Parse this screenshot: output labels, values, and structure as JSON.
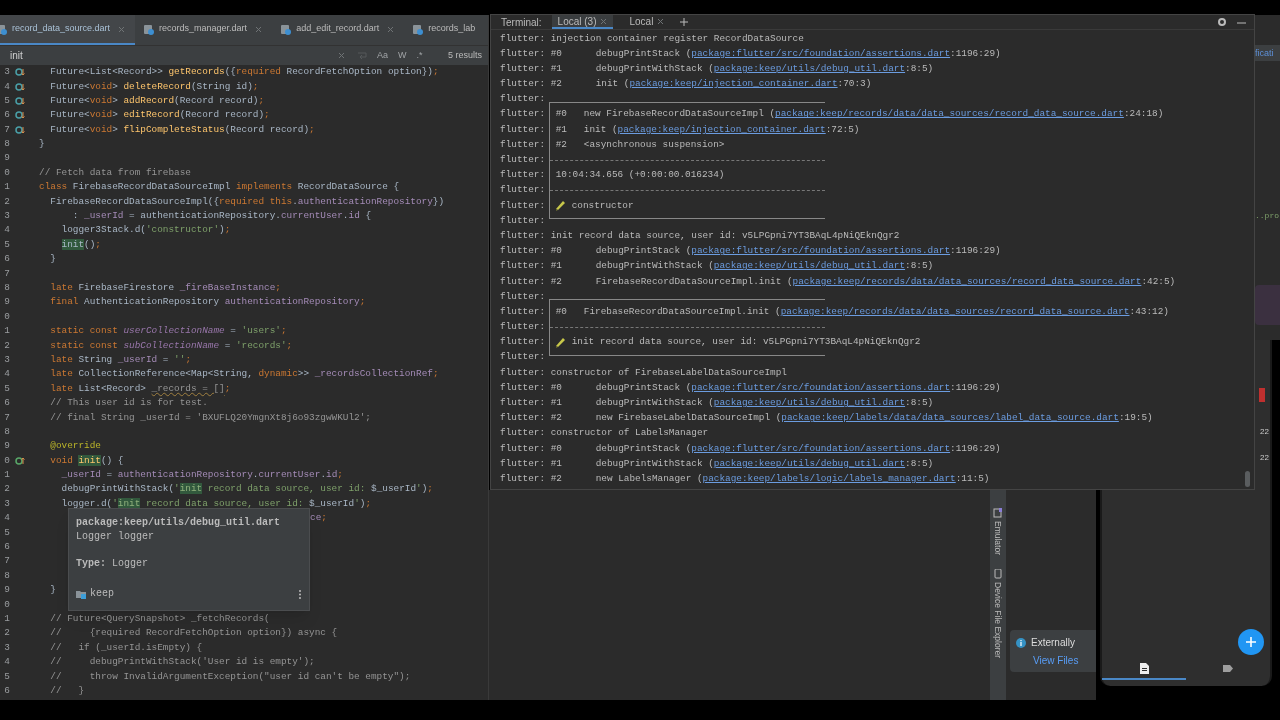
{
  "editor": {
    "tabs": [
      {
        "label": "record_data_source.dart",
        "selected": true,
        "closable": true
      },
      {
        "label": "records_manager.dart",
        "selected": false,
        "closable": true
      },
      {
        "label": "add_edit_record.dart",
        "selected": false,
        "closable": true
      },
      {
        "label": "records_lab",
        "selected": false,
        "closable": false
      }
    ],
    "search": {
      "query": "init",
      "options": [
        "Aa",
        "W",
        ".*"
      ],
      "results": "5 results"
    },
    "lines": [
      {
        "n": "3",
        "code": [
          {
            "t": "  Future<List<Record>> ",
            "kind": "plain"
          },
          {
            "t": "getRecords",
            "kind": "fn"
          },
          {
            "t": "({",
            "kind": "plain"
          },
          {
            "t": "required",
            "kind": "kw"
          },
          {
            "t": " RecordFetchOption option})",
            "kind": "plain"
          },
          {
            "t": ";",
            "kind": "kw"
          }
        ],
        "gutter": {
          "kind": "implemented"
        }
      },
      {
        "n": "4",
        "code": [
          {
            "t": "  Future<",
            "kind": "plain"
          },
          {
            "t": "void",
            "kind": "kw"
          },
          {
            "t": "> ",
            "kind": "plain"
          },
          {
            "t": "deleteRecord",
            "kind": "fn"
          },
          {
            "t": "(String id)",
            "kind": "plain"
          },
          {
            "t": ";",
            "kind": "kw"
          }
        ],
        "gutter": {
          "kind": "implemented"
        }
      },
      {
        "n": "5",
        "code": [
          {
            "t": "  Future<",
            "kind": "plain"
          },
          {
            "t": "void",
            "kind": "kw"
          },
          {
            "t": "> ",
            "kind": "plain"
          },
          {
            "t": "addRecord",
            "kind": "fn"
          },
          {
            "t": "(Record record)",
            "kind": "plain"
          },
          {
            "t": ";",
            "kind": "kw"
          }
        ],
        "gutter": {
          "kind": "implemented"
        }
      },
      {
        "n": "6",
        "code": [
          {
            "t": "  Future<",
            "kind": "plain"
          },
          {
            "t": "void",
            "kind": "kw"
          },
          {
            "t": "> ",
            "kind": "plain"
          },
          {
            "t": "editRecord",
            "kind": "fn"
          },
          {
            "t": "(Record record)",
            "kind": "plain"
          },
          {
            "t": ";",
            "kind": "kw"
          }
        ],
        "gutter": {
          "kind": "implemented"
        }
      },
      {
        "n": "7",
        "code": [
          {
            "t": "  Future<",
            "kind": "plain"
          },
          {
            "t": "void",
            "kind": "kw"
          },
          {
            "t": "> ",
            "kind": "plain"
          },
          {
            "t": "flipCompleteStatus",
            "kind": "fn"
          },
          {
            "t": "(Record record)",
            "kind": "plain"
          },
          {
            "t": ";",
            "kind": "kw"
          }
        ],
        "gutter": {
          "kind": "implemented"
        }
      },
      {
        "n": "8",
        "code": [
          {
            "t": "}",
            "kind": "plain"
          }
        ]
      },
      {
        "n": "9"
      },
      {
        "n": "0",
        "code": [
          {
            "t": "// Fetch data from firebase",
            "kind": "cm"
          }
        ]
      },
      {
        "n": "1",
        "code": [
          {
            "t": "class",
            "kind": "kw"
          },
          {
            "t": " FirebaseRecordDataSourceImpl ",
            "kind": "plain"
          },
          {
            "t": "implements",
            "kind": "kw"
          },
          {
            "t": " RecordDataSource {",
            "kind": "plain"
          }
        ]
      },
      {
        "n": "2",
        "code": [
          {
            "t": "  FirebaseRecordDataSourceImpl({",
            "kind": "plain"
          },
          {
            "t": "required this",
            "kind": "kw"
          },
          {
            "t": ".",
            "kind": "plain"
          },
          {
            "t": "authenticationRepository",
            "kind": "field"
          },
          {
            "t": "})",
            "kind": "plain"
          }
        ]
      },
      {
        "n": "3",
        "code": [
          {
            "t": "      : ",
            "kind": "plain"
          },
          {
            "t": "_userId",
            "kind": "field"
          },
          {
            "t": " = authenticationRepository.",
            "kind": "plain"
          },
          {
            "t": "currentUser",
            "kind": "field"
          },
          {
            "t": ".",
            "kind": "plain"
          },
          {
            "t": "id",
            "kind": "field"
          },
          {
            "t": " {",
            "kind": "plain"
          }
        ]
      },
      {
        "n": "4",
        "code": [
          {
            "t": "    logger3Stack.d(",
            "kind": "plain"
          },
          {
            "t": "'constructor'",
            "kind": "str"
          },
          {
            "t": ")",
            "kind": "plain"
          },
          {
            "t": ";",
            "kind": "kw"
          }
        ]
      },
      {
        "n": "5",
        "code": [
          {
            "t": "    init",
            "kind": "match"
          },
          {
            "t": "()",
            "kind": "plain"
          },
          {
            "t": ";",
            "kind": "kw"
          }
        ]
      },
      {
        "n": "6",
        "code": [
          {
            "t": "  }",
            "kind": "plain"
          }
        ]
      },
      {
        "n": "7"
      },
      {
        "n": "8",
        "code": [
          {
            "t": "  late",
            "kind": "kw"
          },
          {
            "t": " FirebaseFirestore ",
            "kind": "plain"
          },
          {
            "t": "_fireBaseInstance",
            "kind": "field"
          },
          {
            "t": ";",
            "kind": "kw"
          }
        ]
      },
      {
        "n": "9",
        "code": [
          {
            "t": "  final",
            "kind": "kw"
          },
          {
            "t": " AuthenticationRepository ",
            "kind": "plain"
          },
          {
            "t": "authenticationRepository",
            "kind": "field"
          },
          {
            "t": ";",
            "kind": "kw"
          }
        ]
      },
      {
        "n": "0"
      },
      {
        "n": "1",
        "code": [
          {
            "t": "  static const ",
            "kind": "kw"
          },
          {
            "t": "userCollectionName",
            "kind": "sfield"
          },
          {
            "t": " = ",
            "kind": "plain"
          },
          {
            "t": "'users'",
            "kind": "str"
          },
          {
            "t": ";",
            "kind": "kw"
          }
        ]
      },
      {
        "n": "2",
        "code": [
          {
            "t": "  static const ",
            "kind": "kw"
          },
          {
            "t": "subCollectionName",
            "kind": "sfield"
          },
          {
            "t": " = ",
            "kind": "plain"
          },
          {
            "t": "'records'",
            "kind": "str"
          },
          {
            "t": ";",
            "kind": "kw"
          }
        ]
      },
      {
        "n": "3",
        "code": [
          {
            "t": "  late",
            "kind": "kw"
          },
          {
            "t": " String ",
            "kind": "plain"
          },
          {
            "t": "_userId",
            "kind": "field"
          },
          {
            "t": " = ",
            "kind": "plain"
          },
          {
            "t": "''",
            "kind": "str"
          },
          {
            "t": ";",
            "kind": "kw"
          }
        ]
      },
      {
        "n": "4",
        "code": [
          {
            "t": "  late",
            "kind": "kw"
          },
          {
            "t": " CollectionReference<Map<String, ",
            "kind": "plain"
          },
          {
            "t": "dynamic",
            "kind": "kw"
          },
          {
            "t": ">> ",
            "kind": "plain"
          },
          {
            "t": "_recordsCollectionRef",
            "kind": "field"
          },
          {
            "t": ";",
            "kind": "kw"
          }
        ]
      },
      {
        "n": "5",
        "code": [
          {
            "t": "  late",
            "kind": "kw"
          },
          {
            "t": " List<Record> ",
            "kind": "plain"
          },
          {
            "t": "_records = []",
            "kind": "unused"
          },
          {
            "t": ";",
            "kind": "kw"
          }
        ]
      },
      {
        "n": "6",
        "code": [
          {
            "t": "  // This user id is for test.",
            "kind": "cm"
          }
        ]
      },
      {
        "n": "7",
        "code": [
          {
            "t": "  // final String _userId = 'BXUFLQ20YmgnXt8j6o93zgwWKUl2';",
            "kind": "cm"
          }
        ]
      },
      {
        "n": "8"
      },
      {
        "n": "9",
        "code": [
          {
            "t": "  @override",
            "kind": "ann"
          }
        ]
      },
      {
        "n": "0",
        "code": [
          {
            "t": "  void ",
            "kind": "kw"
          },
          {
            "t": "init",
            "kind": "match_fn"
          },
          {
            "t": "() {",
            "kind": "plain"
          }
        ],
        "gutter": {
          "kind": "overrides"
        }
      },
      {
        "n": "1",
        "code": [
          {
            "t": "    _userId",
            "kind": "field"
          },
          {
            "t": " = ",
            "kind": "plain"
          },
          {
            "t": "authenticationRepository",
            "kind": "field"
          },
          {
            "t": ".",
            "kind": "plain"
          },
          {
            "t": "currentUser",
            "kind": "field"
          },
          {
            "t": ".",
            "kind": "plain"
          },
          {
            "t": "id",
            "kind": "field"
          },
          {
            "t": ";",
            "kind": "kw"
          }
        ]
      },
      {
        "n": "2",
        "code": [
          {
            "t": "    debugPrintWithStack(",
            "kind": "plain"
          },
          {
            "t": "'",
            "kind": "str"
          },
          {
            "t": "init",
            "kind": "match_str"
          },
          {
            "t": " record data source, user id: ",
            "kind": "str"
          },
          {
            "t": "$_userId",
            "kind": "plain"
          },
          {
            "t": "'",
            "kind": "str"
          },
          {
            "t": ")",
            "kind": "plain"
          },
          {
            "t": ";",
            "kind": "kw"
          }
        ]
      },
      {
        "n": "3",
        "code": [
          {
            "t": "    logger.d(",
            "kind": "plain"
          },
          {
            "t": "'",
            "kind": "str"
          },
          {
            "t": "init",
            "kind": "match_str"
          },
          {
            "t": " record data source, user id: ",
            "kind": "str"
          },
          {
            "t": "$_userId",
            "kind": "plain"
          },
          {
            "t": "'",
            "kind": "str"
          },
          {
            "t": ")",
            "kind": "plain"
          },
          {
            "t": ";",
            "kind": "kw"
          }
        ]
      },
      {
        "n": "4",
        "covered": true,
        "code": [
          {
            "t": "ce",
            "kind": "field"
          },
          {
            "t": ";",
            "kind": "kw"
          }
        ]
      },
      {
        "n": "5",
        "covered": true
      },
      {
        "n": "6",
        "covered": true
      },
      {
        "n": "7",
        "covered": true
      },
      {
        "n": "8",
        "covered": true
      },
      {
        "n": "9",
        "code": [
          {
            "t": "  }",
            "kind": "plain"
          }
        ]
      },
      {
        "n": "0"
      },
      {
        "n": "1",
        "code": [
          {
            "t": "  // Future<QuerySnapshot> _fetchRecords(",
            "kind": "cm"
          }
        ]
      },
      {
        "n": "2",
        "code": [
          {
            "t": "  //     {required RecordFetchOption option}) async {",
            "kind": "cm"
          }
        ]
      },
      {
        "n": "3",
        "code": [
          {
            "t": "  //   if (_userId.isEmpty) {",
            "kind": "cm"
          }
        ]
      },
      {
        "n": "4",
        "code": [
          {
            "t": "  //     debugPrintWithStack('User id is empty');",
            "kind": "cm"
          }
        ]
      },
      {
        "n": "5",
        "code": [
          {
            "t": "  //     throw InvalidArgumentException(\"user id can't be empty\");",
            "kind": "cm"
          }
        ]
      },
      {
        "n": "6",
        "code": [
          {
            "t": "  //   }",
            "kind": "cm"
          }
        ]
      }
    ],
    "tooltip": {
      "path": "package:keep/utils/debug_util.dart",
      "signature": "Logger logger",
      "type": "**Type:** Logger",
      "module": "keep"
    }
  },
  "terminal": {
    "title": "Terminal:",
    "tabs": [
      {
        "label": "Local (3)",
        "selected": true
      },
      {
        "label": "Local",
        "selected": false
      }
    ],
    "rows": [
      {
        "kind": "plain",
        "prefix": "flutter:",
        "segs": [
          {
            "t": " injection container register RecordDataSource",
            "kind": "text"
          }
        ]
      },
      {
        "kind": "plain",
        "prefix": "flutter:",
        "segs": [
          {
            "t": " #0      debugPrintStack (",
            "kind": "text"
          },
          {
            "t": "package:flutter/src/foundation/assertions.dart",
            "kind": "link"
          },
          {
            "t": ":1196:29)",
            "kind": "text"
          }
        ]
      },
      {
        "kind": "plain",
        "prefix": "flutter:",
        "segs": [
          {
            "t": " #1      debugPrintWithStack (",
            "kind": "text"
          },
          {
            "t": "package:keep/utils/debug_util.dart",
            "kind": "link"
          },
          {
            "t": ":8:5)",
            "kind": "text"
          }
        ]
      },
      {
        "kind": "plain",
        "prefix": "flutter:",
        "segs": [
          {
            "t": " #2      init (",
            "kind": "text"
          },
          {
            "t": "package:keep/injection_container.dart",
            "kind": "link"
          },
          {
            "t": ":70:3)",
            "kind": "text"
          }
        ]
      },
      {
        "kind": "box_top",
        "prefix": "flutter:"
      },
      {
        "kind": "boxed",
        "prefix": "flutter:",
        "segs": [
          {
            "t": " #0   new FirebaseRecordDataSourceImpl (",
            "kind": "text"
          },
          {
            "t": "package:keep/records/data/data_sources/record_data_source.dart",
            "kind": "link"
          },
          {
            "t": ":24:18)",
            "kind": "text"
          }
        ]
      },
      {
        "kind": "boxed",
        "prefix": "flutter:",
        "segs": [
          {
            "t": " #1   init (",
            "kind": "text"
          },
          {
            "t": "package:keep/injection_container.dart",
            "kind": "link"
          },
          {
            "t": ":72:5)",
            "kind": "text"
          }
        ]
      },
      {
        "kind": "boxed",
        "prefix": "flutter:",
        "segs": [
          {
            "t": " #2   <asynchronous suspension>",
            "kind": "text"
          }
        ]
      },
      {
        "kind": "box_divider",
        "prefix": "flutter:"
      },
      {
        "kind": "boxed",
        "prefix": "flutter:",
        "segs": [
          {
            "t": " 10:04:34.656 (+0:00:00.016234)",
            "kind": "text"
          }
        ]
      },
      {
        "kind": "box_divider",
        "prefix": "flutter:"
      },
      {
        "kind": "boxed",
        "prefix": "flutter:",
        "segs": [
          {
            "kind": "icon"
          },
          {
            "t": " constructor",
            "kind": "text"
          }
        ]
      },
      {
        "kind": "box_bottom",
        "prefix": "flutter:"
      },
      {
        "kind": "plain",
        "prefix": "flutter:",
        "segs": [
          {
            "t": " init record data source, user id: v5LPGpni7YT3BAqL4pNiQEknQgr2",
            "kind": "text"
          }
        ]
      },
      {
        "kind": "plain",
        "prefix": "flutter:",
        "segs": [
          {
            "t": " #0      debugPrintStack (",
            "kind": "text"
          },
          {
            "t": "package:flutter/src/foundation/assertions.dart",
            "kind": "link"
          },
          {
            "t": ":1196:29)",
            "kind": "text"
          }
        ]
      },
      {
        "kind": "plain",
        "prefix": "flutter:",
        "segs": [
          {
            "t": " #1      debugPrintWithStack (",
            "kind": "text"
          },
          {
            "t": "package:keep/utils/debug_util.dart",
            "kind": "link"
          },
          {
            "t": ":8:5)",
            "kind": "text"
          }
        ]
      },
      {
        "kind": "plain",
        "prefix": "flutter:",
        "segs": [
          {
            "t": " #2      FirebaseRecordDataSourceImpl.init (",
            "kind": "text"
          },
          {
            "t": "package:keep/records/data/data_sources/record_data_source.dart",
            "kind": "link"
          },
          {
            "t": ":42:5)",
            "kind": "text"
          }
        ]
      },
      {
        "kind": "box_top",
        "prefix": "flutter:"
      },
      {
        "kind": "boxed",
        "prefix": "flutter:",
        "segs": [
          {
            "t": " #0   FirebaseRecordDataSourceImpl.init (",
            "kind": "text"
          },
          {
            "t": "package:keep/records/data/data_sources/record_data_source.dart",
            "kind": "link"
          },
          {
            "t": ":43:12)",
            "kind": "text"
          }
        ]
      },
      {
        "kind": "box_divider",
        "prefix": "flutter:"
      },
      {
        "kind": "boxed",
        "prefix": "flutter:",
        "segs": [
          {
            "kind": "icon"
          },
          {
            "t": " init record data source, user id: v5LPGpni7YT3BAqL4pNiQEknQgr2",
            "kind": "text"
          }
        ]
      },
      {
        "kind": "box_bottom",
        "prefix": "flutter:"
      },
      {
        "kind": "plain",
        "prefix": "flutter:",
        "segs": [
          {
            "t": " constructor of FirebaseLabelDataSourceImpl",
            "kind": "text"
          }
        ]
      },
      {
        "kind": "plain",
        "prefix": "flutter:",
        "segs": [
          {
            "t": " #0      debugPrintStack (",
            "kind": "text"
          },
          {
            "t": "package:flutter/src/foundation/assertions.dart",
            "kind": "link"
          },
          {
            "t": ":1196:29)",
            "kind": "text"
          }
        ]
      },
      {
        "kind": "plain",
        "prefix": "flutter:",
        "segs": [
          {
            "t": " #1      debugPrintWithStack (",
            "kind": "text"
          },
          {
            "t": "package:keep/utils/debug_util.dart",
            "kind": "link"
          },
          {
            "t": ":8:5)",
            "kind": "text"
          }
        ]
      },
      {
        "kind": "plain",
        "prefix": "flutter:",
        "segs": [
          {
            "t": " #2      new FirebaseLabelDataSourceImpl (",
            "kind": "text"
          },
          {
            "t": "package:keep/labels/data/data_sources/label_data_source.dart",
            "kind": "link"
          },
          {
            "t": ":19:5)",
            "kind": "text"
          }
        ]
      },
      {
        "kind": "plain",
        "prefix": "flutter:",
        "segs": [
          {
            "t": " constructor of LabelsManager",
            "kind": "text"
          }
        ]
      },
      {
        "kind": "plain",
        "prefix": "flutter:",
        "segs": [
          {
            "t": " #0      debugPrintStack (",
            "kind": "text"
          },
          {
            "t": "package:flutter/src/foundation/assertions.dart",
            "kind": "link"
          },
          {
            "t": ":1196:29)",
            "kind": "text"
          }
        ]
      },
      {
        "kind": "plain",
        "prefix": "flutter:",
        "segs": [
          {
            "t": " #1      debugPrintWithStack (",
            "kind": "text"
          },
          {
            "t": "package:keep/utils/debug_util.dart",
            "kind": "link"
          },
          {
            "t": ":8:5)",
            "kind": "text"
          }
        ]
      },
      {
        "kind": "plain",
        "prefix": "flutter:",
        "segs": [
          {
            "t": " #2      new LabelsManager (",
            "kind": "text"
          },
          {
            "t": "package:keep/labels/logic/labels_manager.dart",
            "kind": "link"
          },
          {
            "t": ":11:5)",
            "kind": "text"
          }
        ]
      }
    ]
  },
  "background_editor": {
    "tab_fragment": "ficati",
    "code_fragment": "..pro"
  },
  "tool_strip": [
    {
      "label": "Emulator",
      "kind": "emulator"
    },
    {
      "label": "Device File Explorer",
      "kind": "device"
    }
  ],
  "notification": {
    "title": "Externally",
    "link": "View Files"
  },
  "emulator": {
    "list_fragments": [
      "22",
      "22"
    ],
    "nav": [
      {
        "kind": "note",
        "selected": true
      },
      {
        "kind": "label",
        "selected": false
      }
    ]
  }
}
